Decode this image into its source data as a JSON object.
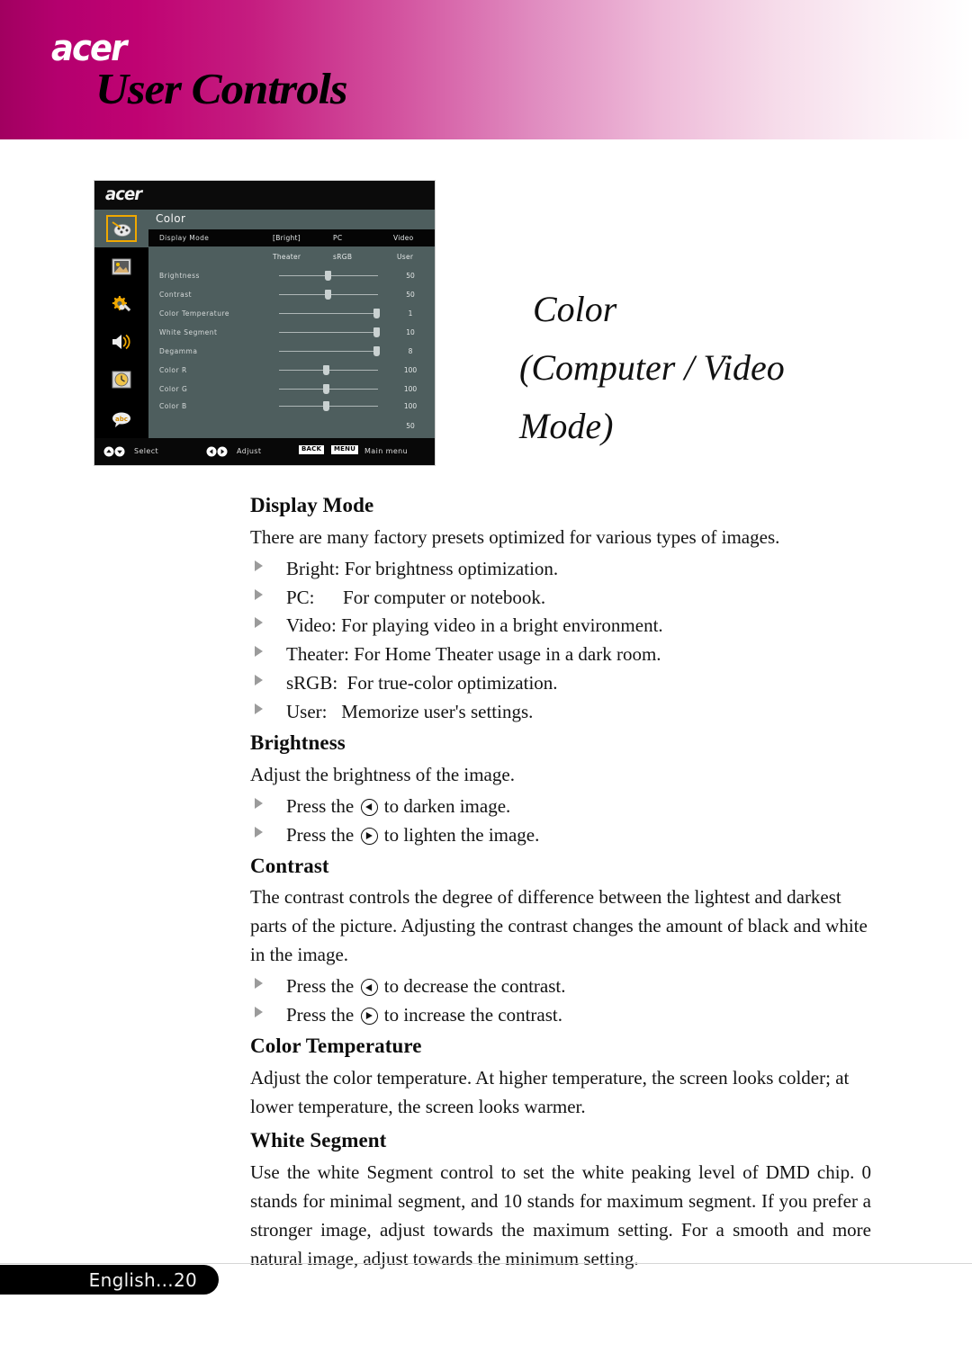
{
  "header": {
    "brand": "acer",
    "title": "User Controls",
    "brand_color": "#ffffff",
    "gradient_start": "#a10060",
    "gradient_end": "#ffffff"
  },
  "side_title": {
    "line1": "Color",
    "line2": "(Computer / Video",
    "line3": "Mode)"
  },
  "osd": {
    "brand": "acer",
    "menu_title": "Color",
    "accent_color": "#f0a800",
    "panel_color": "#4e5e5e",
    "sidebar": [
      {
        "name": "color-palette-icon",
        "label": "Color",
        "selected": true
      },
      {
        "name": "image-icon",
        "label": "Image",
        "selected": false
      },
      {
        "name": "gear-wrench-icon",
        "label": "Management",
        "selected": false
      },
      {
        "name": "speaker-icon",
        "label": "Audio",
        "selected": false
      },
      {
        "name": "clock-icon",
        "label": "Timer",
        "selected": false
      },
      {
        "name": "language-abc-icon",
        "label": "Language",
        "selected": false
      }
    ],
    "display_mode": {
      "label": "Display Mode",
      "row1": [
        "[Bright]",
        "PC",
        "Video"
      ],
      "row2": [
        "Theater",
        "sRGB",
        "User"
      ]
    },
    "rows": [
      {
        "label": "Brightness",
        "value": "50",
        "pos": 50
      },
      {
        "label": "Contrast",
        "value": "50",
        "pos": 50
      },
      {
        "label": "Color Temperature",
        "value": "1",
        "pos": 95
      },
      {
        "label": "White Segment",
        "value": "10",
        "pos": 95
      },
      {
        "label": "Degamma",
        "value": "8",
        "pos": 95
      },
      {
        "label": "Color R",
        "value": "100",
        "pos": 48
      },
      {
        "label": "Color G",
        "value": "100",
        "pos": 48
      },
      {
        "label": "Color B",
        "value": "100",
        "pos": 48
      }
    ],
    "extra_value": "50",
    "footer": {
      "select_label": "Select",
      "adjust_label": "Adjust",
      "back_key": "BACK",
      "menu_key": "MENU",
      "main_menu_label": "Main menu"
    }
  },
  "sections": [
    {
      "heading": "Display Mode",
      "paragraphs": [
        "There are many factory presets optimized for various types of images."
      ],
      "bullets": [
        "Bright: For brightness optimization.",
        "PC:      For computer or notebook.",
        "Video: For playing video in a bright environment.",
        "Theater: For Home Theater usage in a dark room.",
        "sRGB:  For true-color optimization.",
        "User:   Memorize user's settings."
      ]
    },
    {
      "heading": "Brightness",
      "paragraphs": [
        "Adjust the brightness of the image."
      ],
      "key_bullets": [
        {
          "pre": "Press the ",
          "key": "left",
          "post": " to darken image."
        },
        {
          "pre": "Press the ",
          "key": "right",
          "post": " to lighten the image."
        }
      ]
    },
    {
      "heading": "Contrast",
      "paragraphs": [
        "The contrast controls the degree of difference between the lightest and darkest parts of the picture. Adjusting the contrast changes the amount of black and white in the image."
      ],
      "key_bullets": [
        {
          "pre": "Press the ",
          "key": "left",
          "post": " to decrease the contrast."
        },
        {
          "pre": "Press the ",
          "key": "right",
          "post": " to increase the contrast."
        }
      ]
    },
    {
      "heading": "Color Temperature",
      "paragraphs": [
        "Adjust the color temperature. At higher temperature, the screen looks colder; at lower temperature, the screen looks warmer."
      ]
    },
    {
      "heading": "White Segment",
      "paragraphs": [
        "Use the white Segment control to set the white peaking level of DMD chip. 0 stands for minimal segment, and 10 stands for maximum segment. If you prefer a stronger image, adjust towards the maximum setting. For a smooth and more natural image, adjust towards the minimum setting."
      ]
    }
  ],
  "footer": {
    "page_label": "English...20"
  }
}
